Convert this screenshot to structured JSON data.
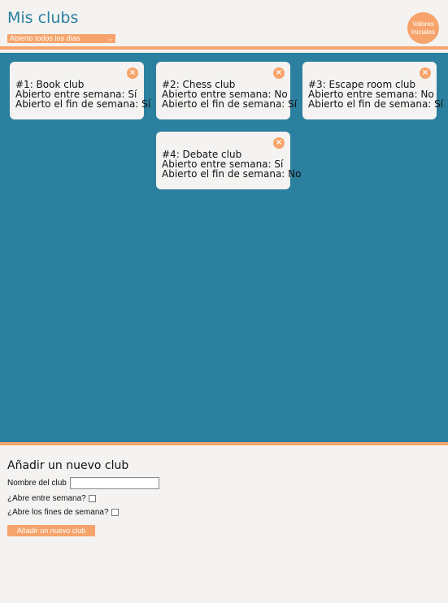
{
  "header": {
    "title": "Mis clubs",
    "filter_selected": "Abierto todos los días",
    "reset_button_line1": "Valores",
    "reset_button_line2": "Iniciales"
  },
  "clubs": [
    {
      "title": "#1: Book club",
      "weekday": "Abierto entre semana: Sí",
      "weekend": "Abierto el fin de semana: Sí"
    },
    {
      "title": "#2: Chess club",
      "weekday": "Abierto entre semana: No",
      "weekend": "Abierto el fin de semana: Sí"
    },
    {
      "title": "#3: Escape room club",
      "weekday": "Abierto entre semana: No",
      "weekend": "Abierto el fin de semana: Sí"
    },
    {
      "title": "#4: Debate club",
      "weekday": "Abierto entre semana: Sí",
      "weekend": "Abierto el fin de semana: No"
    }
  ],
  "form": {
    "heading": "Añadir un nuevo club",
    "name_label": "Nombre del club",
    "name_value": "",
    "weekday_label": "¿Abre entre semana?",
    "weekend_label": "¿Abre los fines de semana?",
    "submit_label": "Añadir un nuevo club"
  },
  "colors": {
    "accent": "#f6a46b",
    "board": "#2b7f9f",
    "title": "#2a7f9f"
  }
}
